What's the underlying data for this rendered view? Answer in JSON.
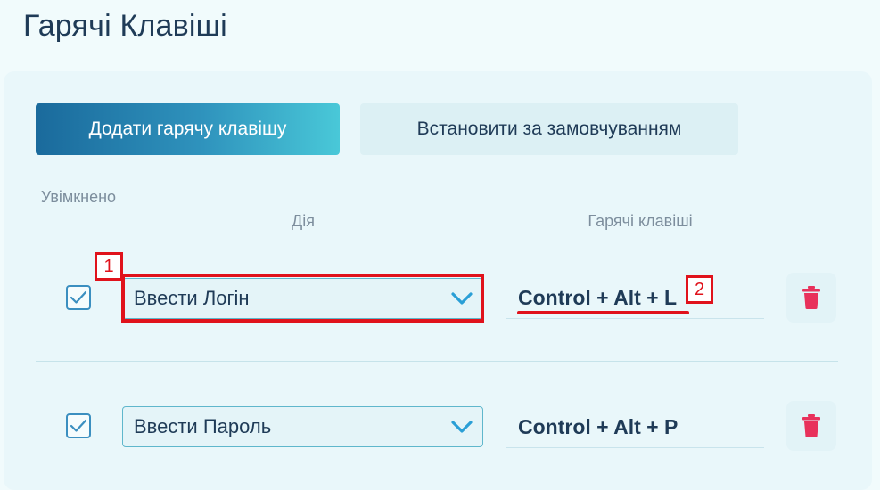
{
  "page": {
    "title": "Гарячі Клавіші"
  },
  "toolbar": {
    "add_label": "Додати гарячу клавішу",
    "default_label": "Встановити за замовчуванням"
  },
  "table": {
    "headers": {
      "enabled": "Увімкнено",
      "action": "Дія",
      "hotkeys": "Гарячі клавіші"
    },
    "rows": [
      {
        "enabled": true,
        "action": "Ввести Логін",
        "hotkey": "Control + Alt + L"
      },
      {
        "enabled": true,
        "action": "Ввести Пароль",
        "hotkey": "Control + Alt + P"
      }
    ]
  },
  "annotations": [
    {
      "label": "1",
      "target": "row-1-action"
    },
    {
      "label": "2",
      "target": "row-1-hotkey"
    }
  ],
  "colors": {
    "accent": "#3b8fc0",
    "delete": "#e8315b",
    "annotation": "#e0121b"
  },
  "icons": {
    "checkbox": "check-icon",
    "dropdown": "chevron-down-icon",
    "delete": "trash-icon"
  }
}
